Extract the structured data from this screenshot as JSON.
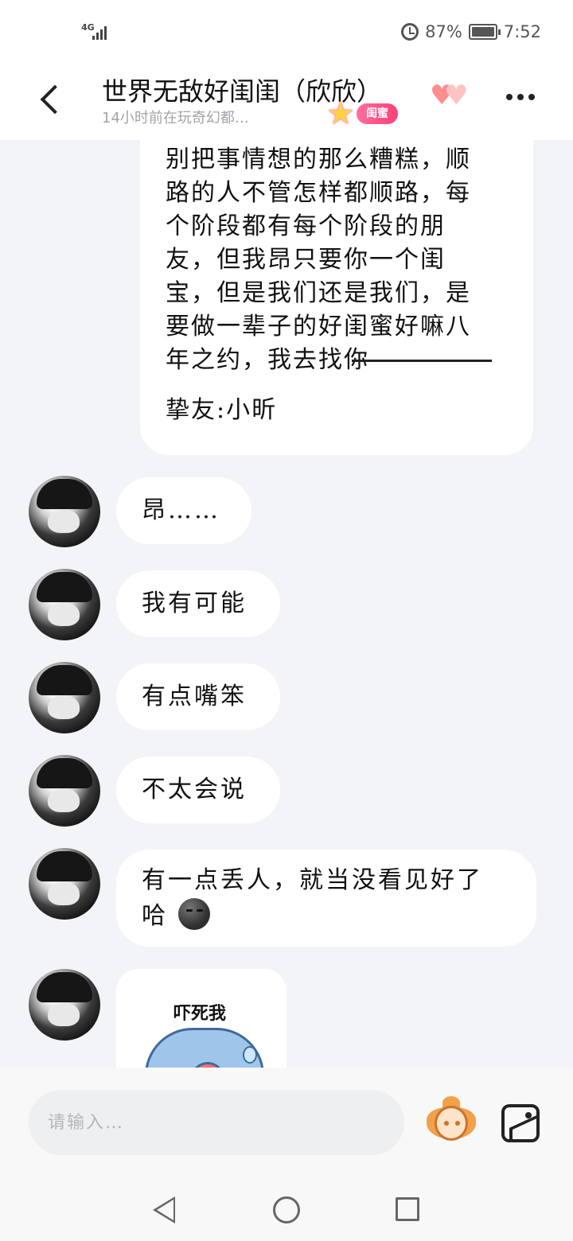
{
  "status_bar": {
    "network": "4G",
    "battery": "87%",
    "time": "7:52"
  },
  "header": {
    "title": "世界无敌好闺闺（欣欣）",
    "subtitle": "14小时前在玩奇幻都…",
    "badge": "闺蜜"
  },
  "messages": {
    "letter_body": "别把事情想的那么糟糕，顺\n路的人不管怎样都顺路，每\n个阶段都有每个阶段的朋\n友，但我昂只要你一个闺\n宝，但是我们还是我们，是\n要做一辈子的好闺蜜好嘛八\n年之约，我去找你",
    "letter_signature": "挚友:小昕",
    "m1": "昂……",
    "m2": "我有可能",
    "m3": "有点嘴笨",
    "m4": "不太会说",
    "m5_line1": "有一点丢人，就当没看见好了",
    "m5_line2": "哈",
    "sticker_text": "吓死我"
  },
  "input": {
    "placeholder": "请输入…"
  },
  "colors": {
    "background": "#f3f4f8",
    "bubble": "#ffffff",
    "badge": "#ff4f80"
  }
}
